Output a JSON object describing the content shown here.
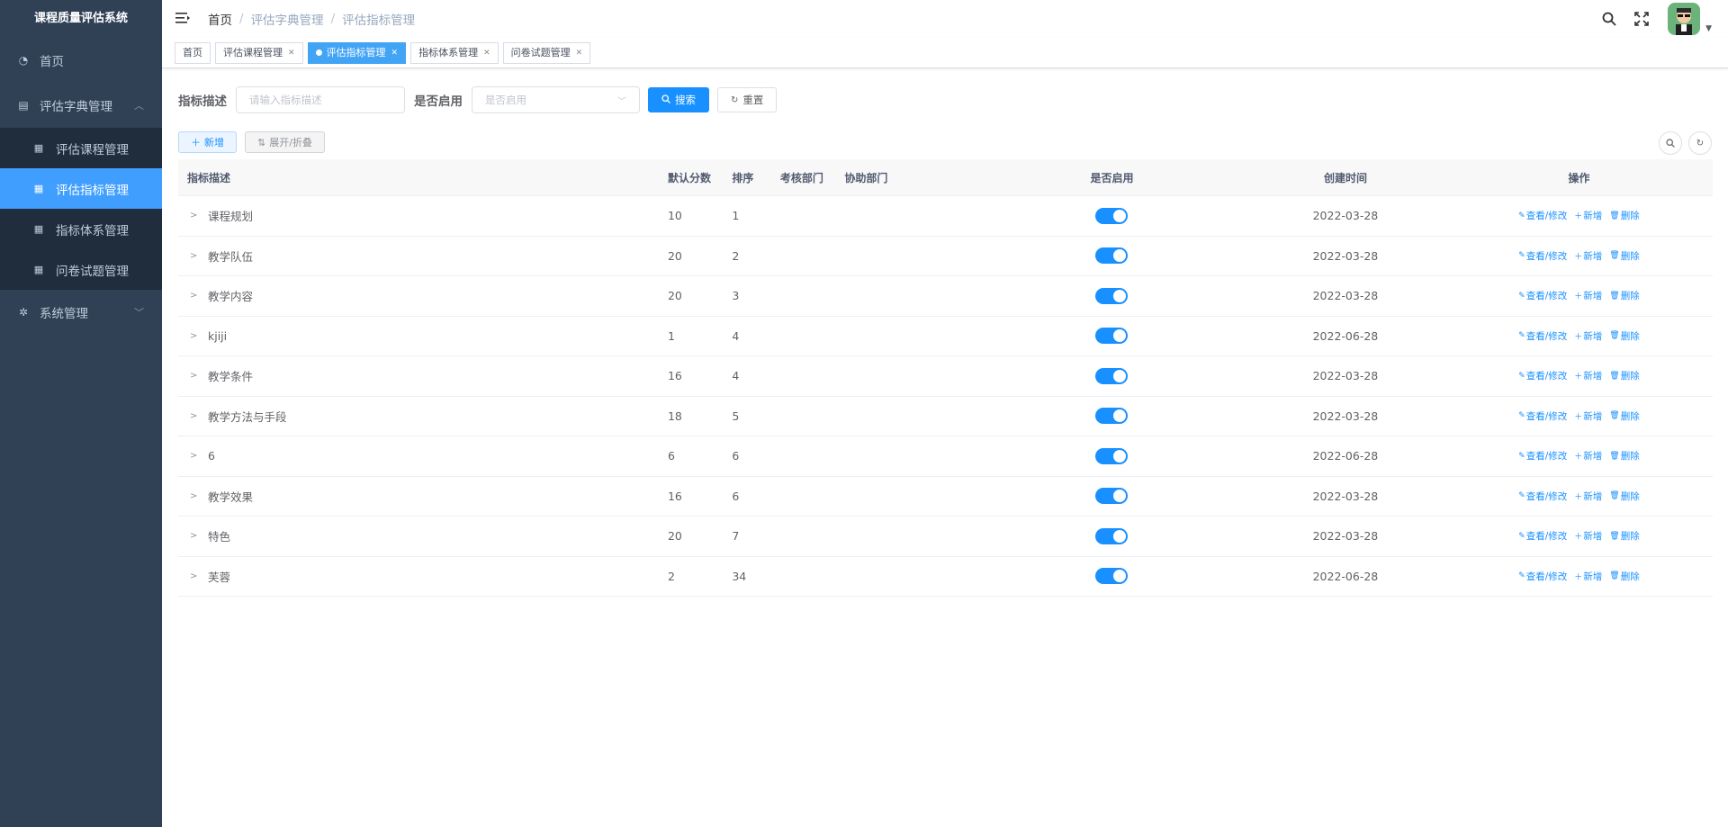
{
  "app": {
    "title": "课程质量评估系统"
  },
  "sidebar": {
    "items": [
      {
        "label": "首页",
        "icon": "dashboard-icon"
      },
      {
        "label": "评估字典管理",
        "icon": "dictionary-icon",
        "expanded": true,
        "children": [
          {
            "label": "评估课程管理",
            "icon": "document-icon",
            "active": false
          },
          {
            "label": "评估指标管理",
            "icon": "document-icon",
            "active": true
          },
          {
            "label": "指标体系管理",
            "icon": "document-icon",
            "active": false
          },
          {
            "label": "问卷试题管理",
            "icon": "document-icon",
            "active": false
          }
        ]
      },
      {
        "label": "系统管理",
        "icon": "gear-icon",
        "expanded": false
      }
    ]
  },
  "breadcrumb": [
    "首页",
    "评估字典管理",
    "评估指标管理"
  ],
  "tags": [
    {
      "label": "首页",
      "active": false,
      "closable": false
    },
    {
      "label": "评估课程管理",
      "active": false,
      "closable": true
    },
    {
      "label": "评估指标管理",
      "active": true,
      "closable": true
    },
    {
      "label": "指标体系管理",
      "active": false,
      "closable": true
    },
    {
      "label": "问卷试题管理",
      "active": false,
      "closable": true
    }
  ],
  "search": {
    "desc_label": "指标描述",
    "desc_placeholder": "请输入指标描述",
    "enable_label": "是否启用",
    "enable_placeholder": "是否启用",
    "search_btn": "搜索",
    "reset_btn": "重置"
  },
  "toolbar": {
    "add_btn": "新增",
    "toggle_btn": "展开/折叠"
  },
  "table": {
    "headers": [
      "指标描述",
      "默认分数",
      "排序",
      "考核部门",
      "协助部门",
      "是否启用",
      "创建时间",
      "操作"
    ],
    "ops": {
      "view": "查看/修改",
      "add": "新增",
      "delete": "删除"
    },
    "rows": [
      {
        "desc": "课程规划",
        "score": "10",
        "order": "1",
        "dept": "",
        "assist": "",
        "enabled": true,
        "date": "2022-03-28"
      },
      {
        "desc": "教学队伍",
        "score": "20",
        "order": "2",
        "dept": "",
        "assist": "",
        "enabled": true,
        "date": "2022-03-28"
      },
      {
        "desc": "教学内容",
        "score": "20",
        "order": "3",
        "dept": "",
        "assist": "",
        "enabled": true,
        "date": "2022-03-28"
      },
      {
        "desc": "kjiji",
        "score": "1",
        "order": "4",
        "dept": "",
        "assist": "",
        "enabled": true,
        "date": "2022-06-28"
      },
      {
        "desc": "教学条件",
        "score": "16",
        "order": "4",
        "dept": "",
        "assist": "",
        "enabled": true,
        "date": "2022-03-28"
      },
      {
        "desc": "教学方法与手段",
        "score": "18",
        "order": "5",
        "dept": "",
        "assist": "",
        "enabled": true,
        "date": "2022-03-28"
      },
      {
        "desc": "6",
        "score": "6",
        "order": "6",
        "dept": "",
        "assist": "",
        "enabled": true,
        "date": "2022-06-28"
      },
      {
        "desc": "教学效果",
        "score": "16",
        "order": "6",
        "dept": "",
        "assist": "",
        "enabled": true,
        "date": "2022-03-28"
      },
      {
        "desc": "特色",
        "score": "20",
        "order": "7",
        "dept": "",
        "assist": "",
        "enabled": true,
        "date": "2022-03-28"
      },
      {
        "desc": "芙蓉",
        "score": "2",
        "order": "34",
        "dept": "",
        "assist": "",
        "enabled": true,
        "date": "2022-06-28"
      }
    ]
  },
  "colors": {
    "sidebar_bg": "#304156",
    "accent": "#1890ff",
    "active_menu": "#409eff"
  }
}
